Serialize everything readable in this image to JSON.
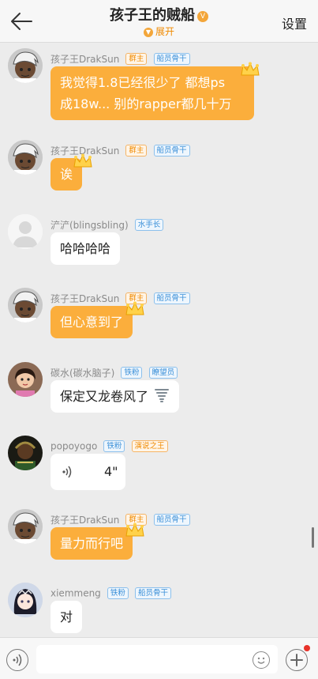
{
  "header": {
    "title": "孩子王的贼船",
    "title_badge": "V",
    "expand_label": "展开",
    "settings_label": "设置"
  },
  "messages": [
    {
      "sender": "孩子王DrakSun",
      "tags": [
        "群主",
        "船员骨干"
      ],
      "text_lines": [
        "我觉得1.8已经很少了 都想ps",
        "成18w... 别的rapper都几十万"
      ],
      "style": "orange",
      "avatar": "cartoon-boy"
    },
    {
      "sender": "孩子王DrakSun",
      "tags": [
        "群主",
        "船员骨干"
      ],
      "text": "诶",
      "style": "orange",
      "avatar": "cartoon-boy"
    },
    {
      "sender": "浐浐(blingsbling)",
      "tags": [
        "水手长"
      ],
      "text": "哈哈哈哈",
      "style": "white",
      "avatar": "default"
    },
    {
      "sender": "孩子王DrakSun",
      "tags": [
        "群主",
        "船员骨干"
      ],
      "text": "但心意到了",
      "style": "orange",
      "avatar": "cartoon-boy"
    },
    {
      "sender": "碳水(碳水脑子)",
      "tags": [
        "铁粉",
        "瞭望员"
      ],
      "text": "保定又龙卷风了",
      "emoji": "tornado-icon",
      "style": "white",
      "avatar": "girl-photo"
    },
    {
      "sender": "popoyogo",
      "tags": [
        "铁粉",
        "演说之王"
      ],
      "voice_duration": "4\"",
      "style": "white",
      "avatar": "dark-photo"
    },
    {
      "sender": "孩子王DrakSun",
      "tags": [
        "群主",
        "船员骨干"
      ],
      "text": "量力而行吧",
      "style": "orange",
      "avatar": "cartoon-boy"
    },
    {
      "sender": "xiemmeng",
      "tags": [
        "铁粉",
        "船员骨干"
      ],
      "text": "对",
      "style": "white",
      "avatar": "anime-girl"
    }
  ],
  "colors": {
    "accent": "#fbae3c",
    "tag_orange": "#f08a00",
    "tag_blue": "#3a8fd8"
  },
  "bottom_bar": {
    "voice_icon": "voice-icon",
    "emoji_icon": "emoji-icon",
    "plus_icon": "plus-icon"
  }
}
